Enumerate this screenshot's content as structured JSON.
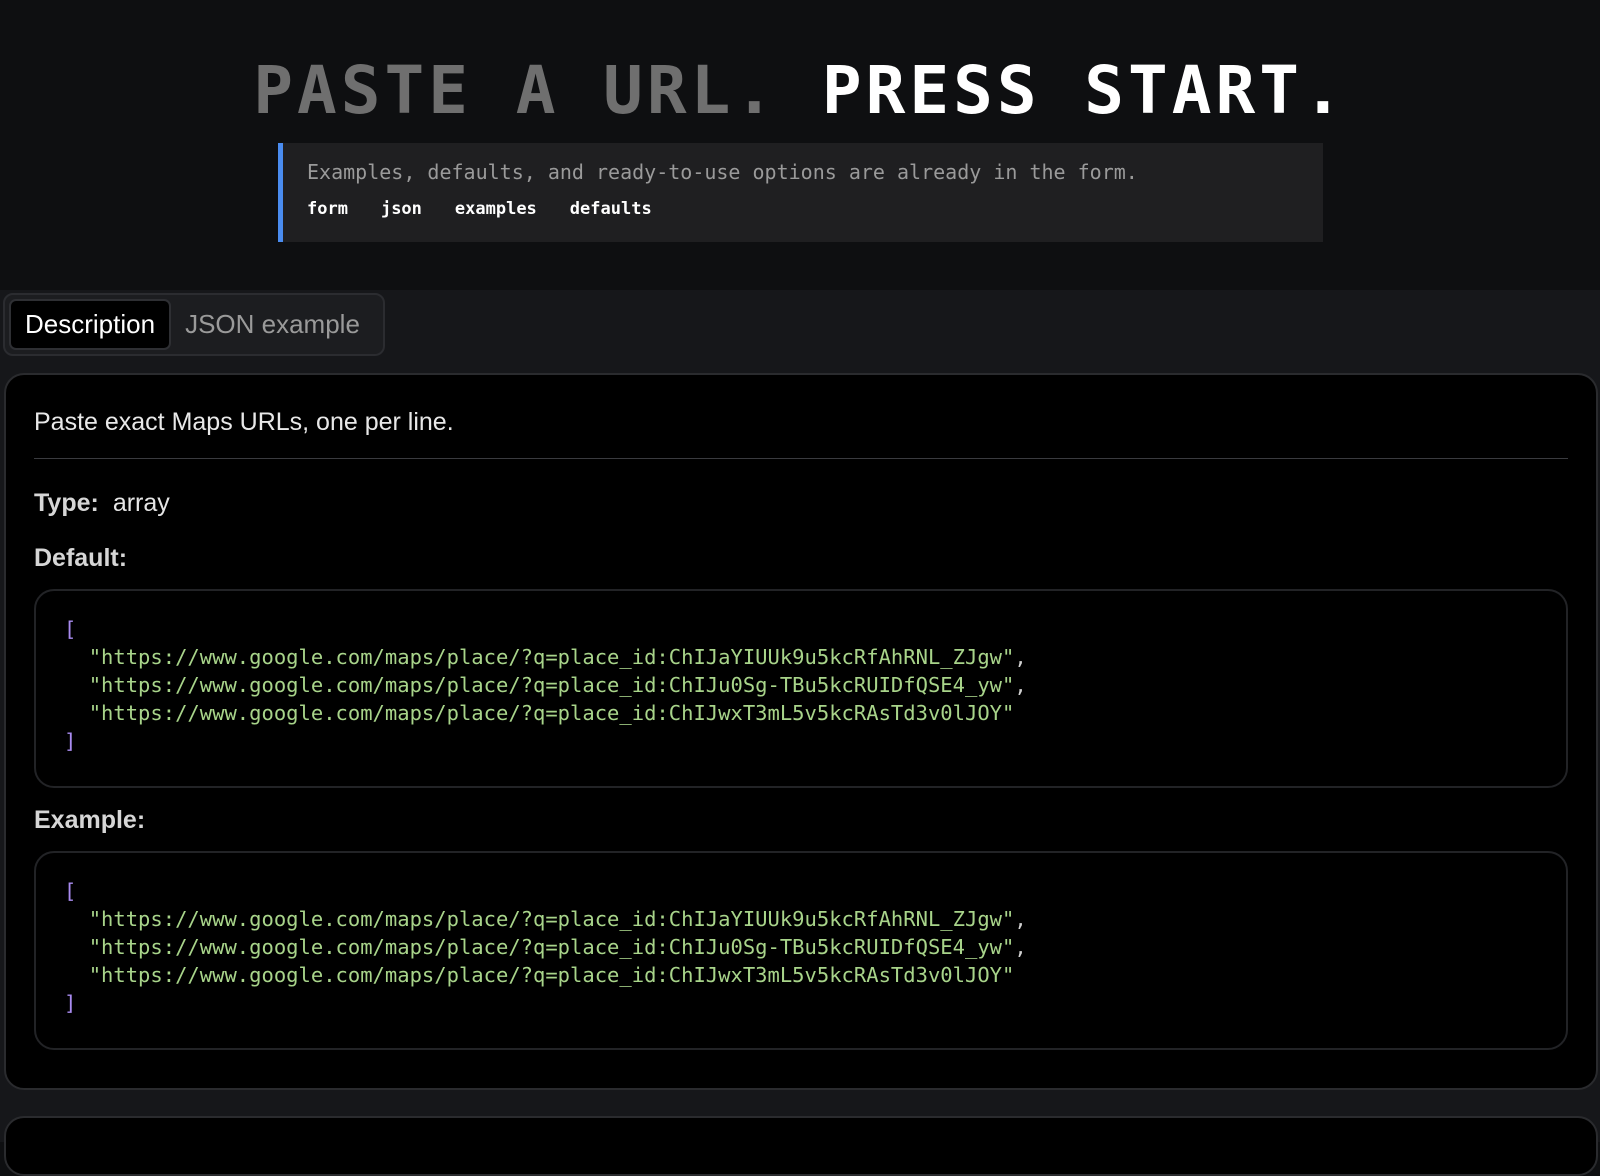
{
  "hero": {
    "title_dim": "PASTE A URL.",
    "title_bright": "PRESS START.",
    "callout_text": "Examples, defaults, and ready-to-use options are already in the form.",
    "tags": [
      "form",
      "json",
      "examples",
      "defaults"
    ],
    "accent_color": "#4a8cf0"
  },
  "tabs": {
    "items": [
      {
        "label": "Description",
        "active": true
      },
      {
        "label": "JSON example",
        "active": false
      }
    ]
  },
  "panel": {
    "description": "Paste exact Maps URLs, one per line.",
    "type_label": "Type:",
    "type_value": "array",
    "default_label": "Default:",
    "example_label": "Example:",
    "default_values": [
      "https://www.google.com/maps/place/?q=place_id:ChIJaYIUUk9u5kcRfAhRNL_ZJgw",
      "https://www.google.com/maps/place/?q=place_id:ChIJu0Sg-TBu5kcRUIDfQSE4_yw",
      "https://www.google.com/maps/place/?q=place_id:ChIJwxT3mL5v5kcRAsTd3v0lJOY"
    ],
    "example_values": [
      "https://www.google.com/maps/place/?q=place_id:ChIJaYIUUk9u5kcRfAhRNL_ZJgw",
      "https://www.google.com/maps/place/?q=place_id:ChIJu0Sg-TBu5kcRUIDfQSE4_yw",
      "https://www.google.com/maps/place/?q=place_id:ChIJwxT3mL5v5kcRAsTd3v0lJOY"
    ]
  }
}
